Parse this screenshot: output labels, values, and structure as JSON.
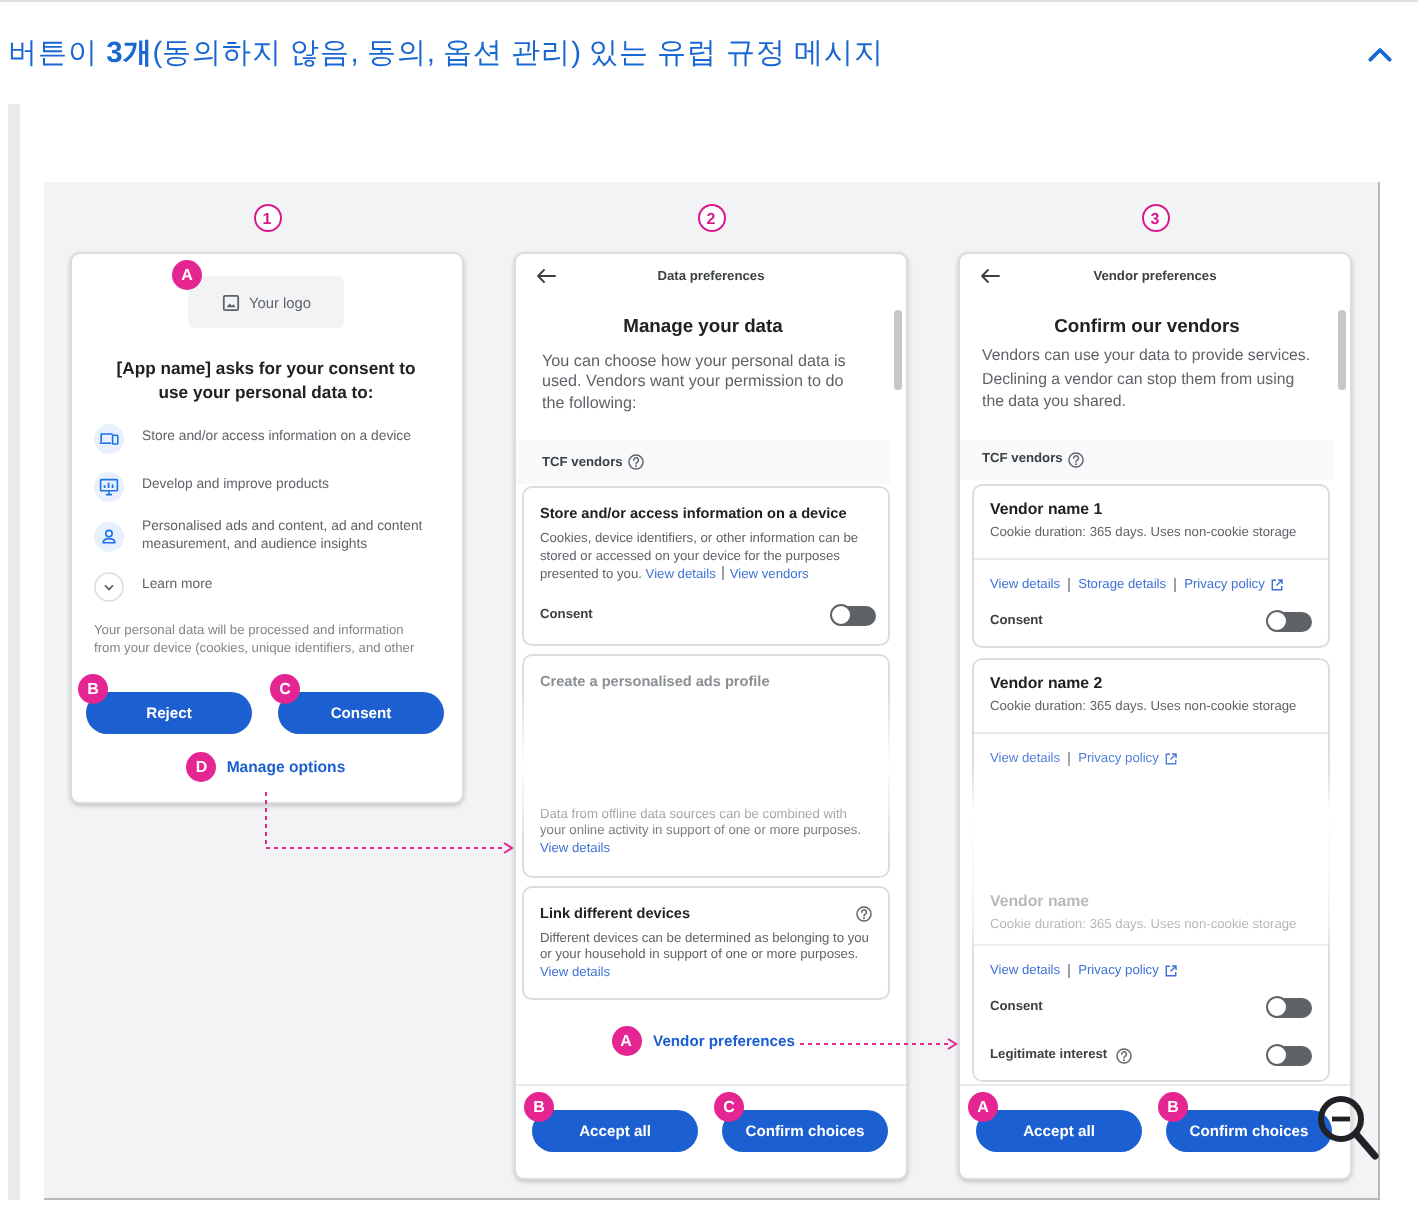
{
  "header": {
    "title": "버튼이 **3개**(동의하지 않음, 동의, 옵션 관리) 있는 유럽 규정 메시지",
    "expanded": true
  },
  "figure": {
    "consent_screen": {
      "step": "1",
      "logo": {
        "callout": "A",
        "label": "Your logo"
      },
      "heading": "[App name] asks for your consent to use your personal data to:",
      "purposes": [
        "Store and/or access information on a device",
        "Develop and improve products",
        "Personalised ads and content, ad and content measurement, and audience insights"
      ],
      "learn_more": "Learn more",
      "notice": "Your personal data will be processed and information from your device (cookies, unique identifiers, and other",
      "buttons": [
        {
          "callout": "B",
          "label": "Reject"
        },
        {
          "callout": "C",
          "label": "Consent"
        }
      ],
      "manage_link": {
        "callout": "D",
        "label": "Manage options"
      }
    },
    "data_preferences_screen": {
      "step": "2",
      "title": "Data preferences",
      "heading": "Manage your data",
      "intro": "You can choose how your personal data is used. Vendors want your permission to do the following:",
      "section_label": "TCF vendors",
      "purposes": [
        {
          "kind": "full",
          "title": "Store and/or access information on a device",
          "help": false,
          "description": "Cookies, device identifiers, or other information can be stored or accessed on your device for the purposes presented to you.",
          "links": [
            {
              "label": "View details",
              "external": false
            },
            {
              "label": "View vendors",
              "external": false
            }
          ],
          "toggles": [
            {
              "label": "Consent",
              "help": false,
              "on": false
            }
          ]
        },
        {
          "kind": "head",
          "title": "Create a personalised ads profile",
          "help": false
        },
        {
          "kind": "tail",
          "help": false,
          "description": "Data from offline data sources can be combined with your online activity in support of one or more purposes.",
          "links": [
            {
              "label": "View details",
              "external": false
            }
          ]
        },
        {
          "kind": "full",
          "title": "Link different devices",
          "help": true,
          "description": "Different devices can be determined as belonging to you or your household in support of one or more purposes.",
          "links": [
            {
              "label": "View details",
              "external": false
            }
          ]
        }
      ],
      "vendor_link": {
        "callout": "A",
        "label": "Vendor preferences"
      },
      "buttons": [
        {
          "callout": "B",
          "label": "Accept all"
        },
        {
          "callout": "C",
          "label": "Confirm choices"
        }
      ]
    },
    "vendor_preferences_screen": {
      "step": "3",
      "title": "Vendor preferences",
      "heading": "Confirm our vendors",
      "intro": "Vendors can use your data to provide services. Declining a vendor can stop them from using the data you shared.",
      "section_label": "TCF vendors",
      "vendors": [
        {
          "kind": "full",
          "name": "Vendor name 1",
          "duration": "Cookie duration: 365 days. Uses non-cookie storage",
          "links": [
            {
              "label": "View details",
              "external": false
            },
            {
              "label": "Storage details",
              "external": false
            },
            {
              "label": "Privacy policy",
              "external": true
            }
          ],
          "toggles": [
            {
              "label": "Consent",
              "help": false,
              "on": false
            }
          ]
        },
        {
          "kind": "head",
          "name": "Vendor name 2",
          "duration": "Cookie duration: 365 days. Uses non-cookie storage",
          "links": [
            {
              "label": "View details",
              "external": false
            },
            {
              "label": "Privacy policy",
              "external": true
            }
          ]
        },
        {
          "kind": "tail",
          "name": "Vendor name",
          "duration": "Cookie duration: 365 days. Uses non-cookie storage",
          "links": [
            {
              "label": "View details",
              "external": false
            },
            {
              "label": "Privacy policy",
              "external": true
            }
          ],
          "toggles": [
            {
              "label": "Consent",
              "help": false,
              "on": false
            },
            {
              "label": "Legitimate interest",
              "help": true,
              "on": false
            }
          ]
        }
      ],
      "buttons": [
        {
          "callout": "A",
          "label": "Accept all"
        },
        {
          "callout": "B",
          "label": "Confirm choices"
        }
      ]
    }
  }
}
